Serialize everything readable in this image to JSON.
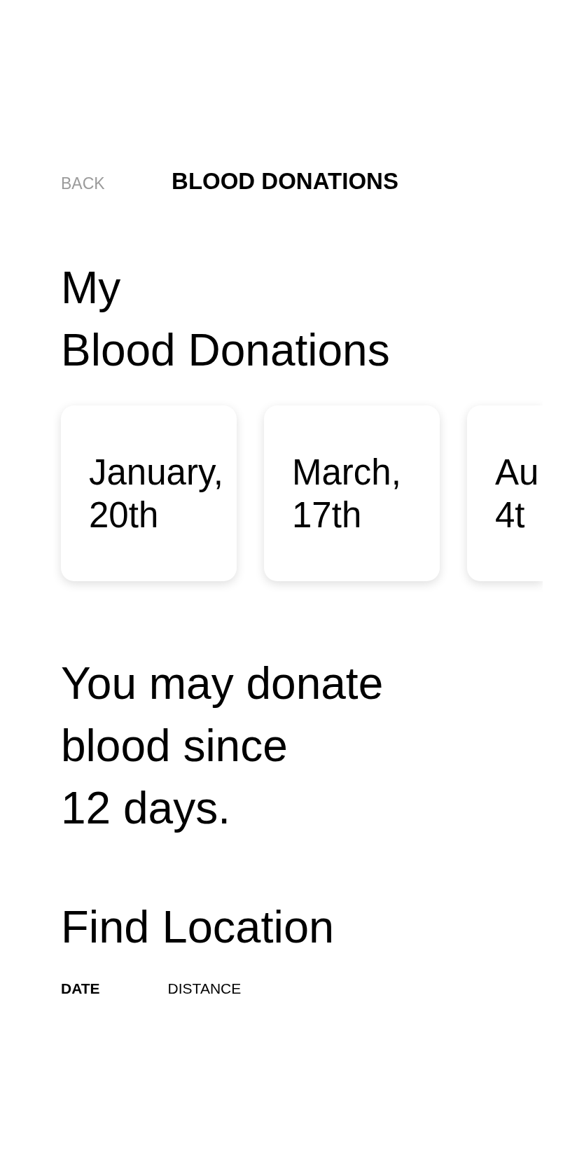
{
  "header": {
    "back_label": "BACK",
    "title": "BLOOD DONATIONS"
  },
  "donations": {
    "title": "My\nBlood Donations",
    "cards": [
      {
        "date": "January,\n20th"
      },
      {
        "date": "March,\n17th"
      },
      {
        "date": "Au\n4t"
      }
    ]
  },
  "eligibility": {
    "message": "You may donate\nblood since\n12 days."
  },
  "find_location": {
    "title": "Find Location",
    "tabs": [
      {
        "label": "DATE",
        "selected": true
      },
      {
        "label": "DISTANCE",
        "selected": false
      }
    ]
  }
}
